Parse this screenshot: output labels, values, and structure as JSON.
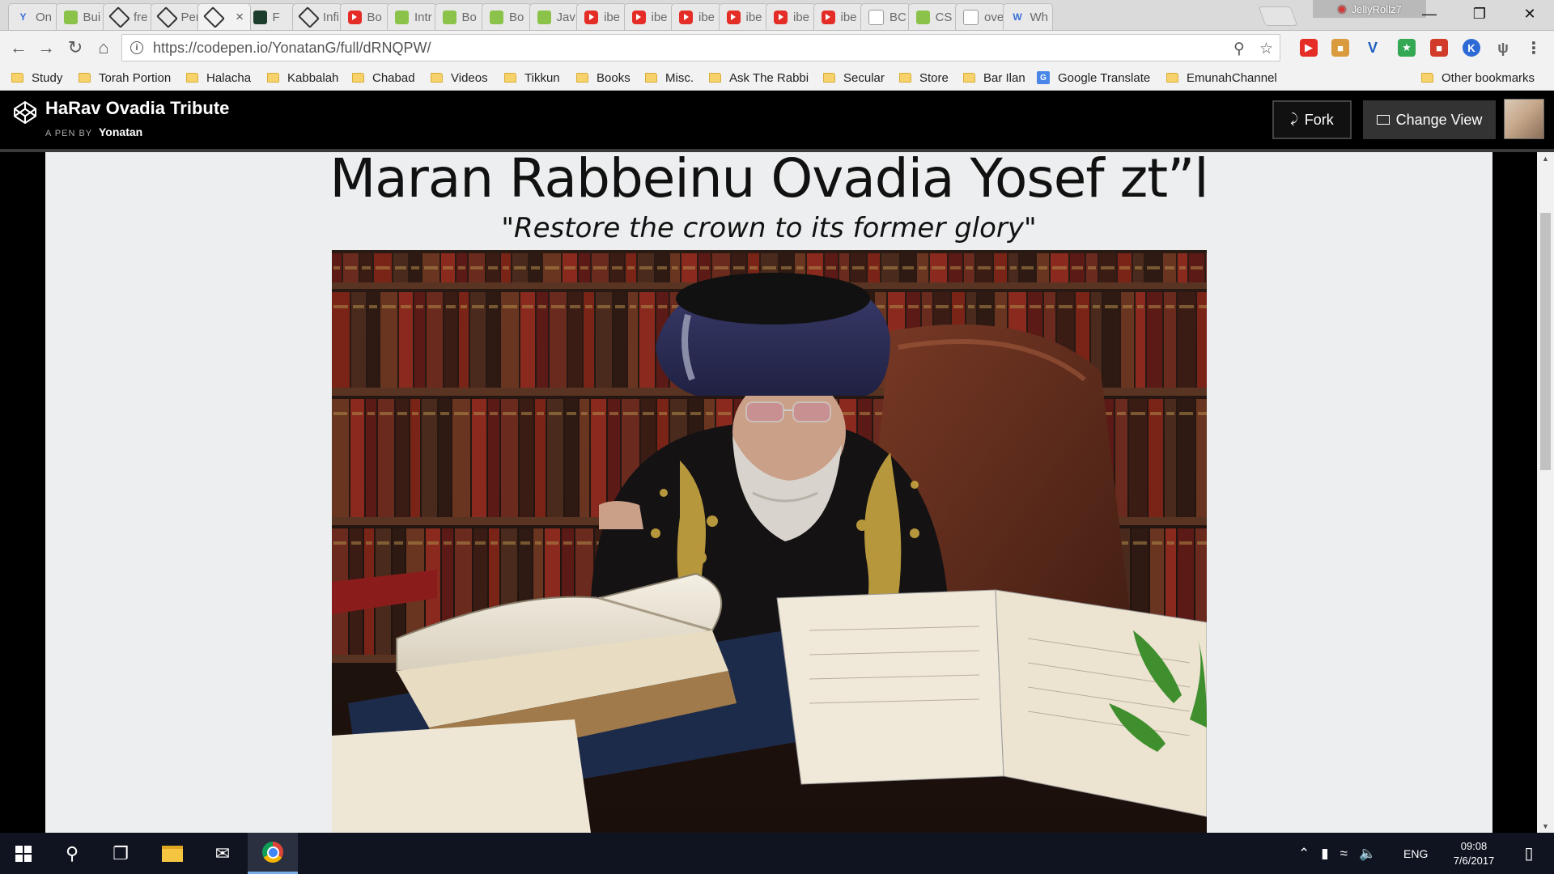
{
  "browser": {
    "tabs": [
      {
        "label": "On",
        "icon": "v-icon",
        "active": false
      },
      {
        "label": "Bui",
        "icon": "image-icon",
        "active": false
      },
      {
        "label": "fre",
        "icon": "codepen-icon",
        "active": false
      },
      {
        "label": "Per",
        "icon": "codepen-icon",
        "active": false
      },
      {
        "label": "",
        "icon": "codepen-icon",
        "active": true
      },
      {
        "label": "F",
        "icon": "audio-icon",
        "active": false
      },
      {
        "label": "Infi",
        "icon": "codepen-icon",
        "active": false
      },
      {
        "label": "Bo",
        "icon": "youtube-icon",
        "active": false
      },
      {
        "label": "Intr",
        "icon": "green-icon",
        "active": false
      },
      {
        "label": "Bo",
        "icon": "green-icon",
        "active": false
      },
      {
        "label": "Bo",
        "icon": "green-icon",
        "active": false
      },
      {
        "label": "Jav",
        "icon": "green-icon",
        "active": false
      },
      {
        "label": "ibe",
        "icon": "youtube-icon",
        "active": false
      },
      {
        "label": "ibe",
        "icon": "youtube-icon",
        "active": false
      },
      {
        "label": "ibe",
        "icon": "youtube-icon",
        "active": false
      },
      {
        "label": "ibe",
        "icon": "youtube-icon",
        "active": false
      },
      {
        "label": "ibe",
        "icon": "youtube-icon",
        "active": false
      },
      {
        "label": "ibe",
        "icon": "youtube-icon",
        "active": false
      },
      {
        "label": "BC",
        "icon": "doc-icon",
        "active": false
      },
      {
        "label": "CS",
        "icon": "green-icon",
        "active": false
      },
      {
        "label": "ove",
        "icon": "flame-icon",
        "active": false
      },
      {
        "label": "Wh",
        "icon": "w-icon",
        "active": false
      }
    ],
    "profile_name": "JellyRollz7",
    "url": "https://codepen.io/YonatanG/full/dRNQPW/",
    "bookmarks": [
      {
        "label": "Study",
        "type": "folder"
      },
      {
        "label": "Torah Portion",
        "type": "folder"
      },
      {
        "label": "Halacha",
        "type": "folder"
      },
      {
        "label": "Kabbalah",
        "type": "folder"
      },
      {
        "label": "Chabad",
        "type": "folder"
      },
      {
        "label": "Videos",
        "type": "folder"
      },
      {
        "label": "Tikkun",
        "type": "folder"
      },
      {
        "label": "Books",
        "type": "folder"
      },
      {
        "label": "Misc.",
        "type": "folder"
      },
      {
        "label": "Ask The Rabbi",
        "type": "folder"
      },
      {
        "label": "Secular",
        "type": "folder"
      },
      {
        "label": "Store",
        "type": "folder"
      },
      {
        "label": "Bar Ilan",
        "type": "folder"
      },
      {
        "label": "Google Translate",
        "type": "link"
      },
      {
        "label": "EmunahChannel",
        "type": "folder"
      }
    ],
    "other_bookmarks": "Other bookmarks"
  },
  "codepen": {
    "pen_title": "HaRav Ovadia Tribute",
    "pen_by_label": "A PEN BY",
    "author": "Yonatan",
    "fork_label": "Fork",
    "change_view_label": "Change View"
  },
  "page": {
    "title": "Maran Rabbeinu Ovadia Yosef zt”l",
    "subtitle_open_quote": "\"",
    "subtitle": "Restore the crown to its former glory",
    "subtitle_close_quote": "\""
  },
  "taskbar": {
    "language": "ENG",
    "time": "09:08",
    "date": "7/6/2017"
  },
  "colors": {
    "codepen_bg": "#000000",
    "page_bg": "#eceeef",
    "taskbar_bg": "#101420"
  }
}
